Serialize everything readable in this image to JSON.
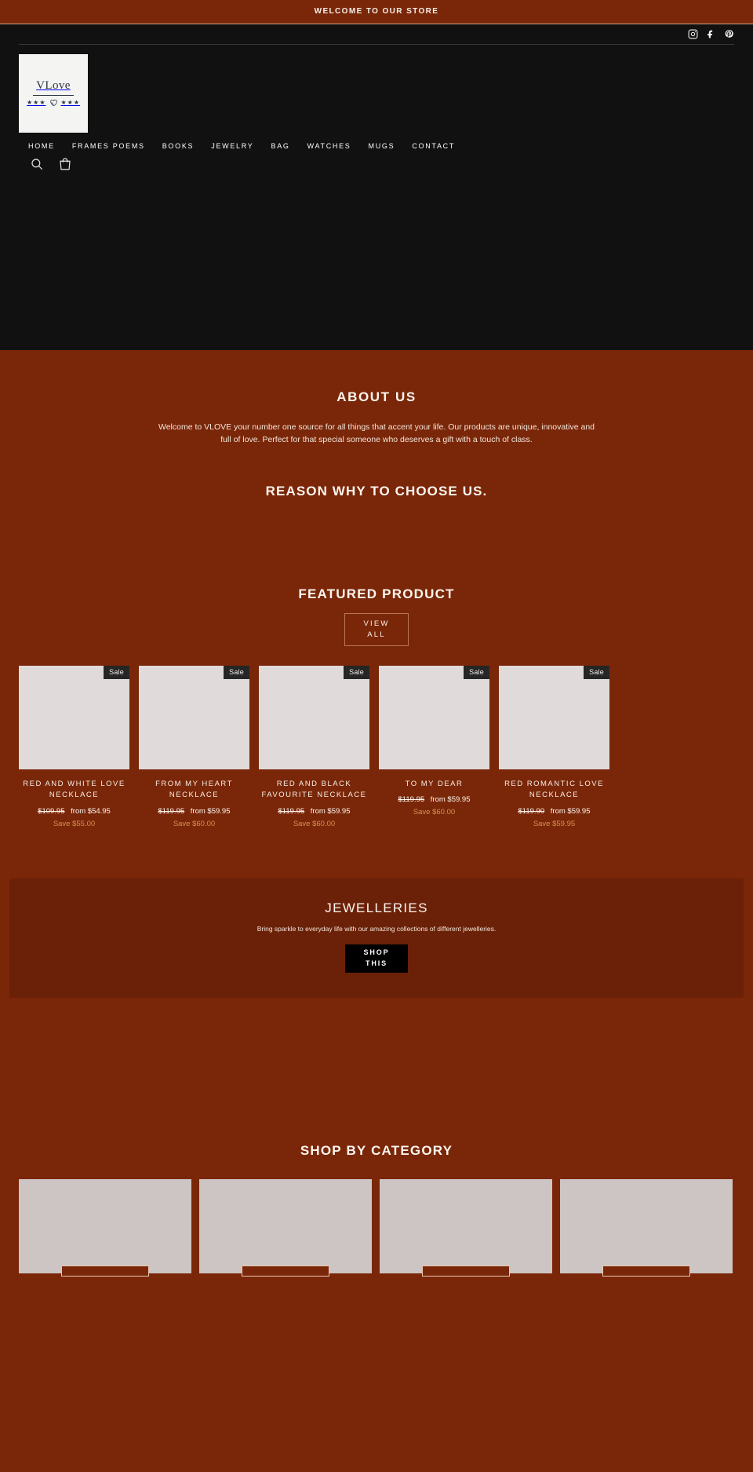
{
  "announcement": {
    "text": "WELCOME TO OUR STORE"
  },
  "social": [
    {
      "name": "instagram-icon",
      "label": "Instagram"
    },
    {
      "name": "facebook-icon",
      "label": "Facebook"
    },
    {
      "name": "pinterest-icon",
      "label": "Pinterest"
    }
  ],
  "logo": {
    "name": "VLove",
    "stars_left": "★★★",
    "stars_right": "★★★"
  },
  "nav": [
    {
      "label": "HOME"
    },
    {
      "label": "FRAMES POEMS"
    },
    {
      "label": "BOOKS"
    },
    {
      "label": "JEWELRY"
    },
    {
      "label": "BAG"
    },
    {
      "label": "WATCHES"
    },
    {
      "label": "MUGS"
    },
    {
      "label": "CONTACT"
    }
  ],
  "utilities": [
    {
      "name": "search-icon",
      "label": "Search"
    },
    {
      "name": "cart-icon",
      "label": "Cart"
    }
  ],
  "about": {
    "title": "ABOUT US",
    "body": "Welcome to VLOVE your number one source for all things that accent your life. Our products are unique, innovative and full of love. Perfect for that special someone who deserves a gift with a touch of class."
  },
  "reason": {
    "title": "REASON WHY TO CHOOSE US."
  },
  "featured": {
    "title": "FEATURED PRODUCT",
    "view_all_line1": "VIEW",
    "view_all_line2": "ALL",
    "badge_label": "Sale",
    "products": [
      {
        "title": "RED AND WHITE LOVE NECKLACE",
        "old_price": "$109.95",
        "new_price": "from $54.95",
        "save": "Save $55.00",
        "badge": "Sale"
      },
      {
        "title": "FROM MY HEART NECKLACE",
        "old_price": "$119.95",
        "new_price": "from $59.95",
        "save": "Save $60.00",
        "badge": "Sale"
      },
      {
        "title": "RED AND BLACK FAVOURITE NECKLACE",
        "old_price": "$119.95",
        "new_price": "from $59.95",
        "save": "Save $60.00",
        "badge": "Sale"
      },
      {
        "title": "TO MY DEAR",
        "old_price": "$119.95",
        "new_price": "from $59.95",
        "save": "Save $60.00",
        "badge": "Sale"
      },
      {
        "title": "RED ROMANTIC LOVE NECKLACE",
        "old_price": "$119.90",
        "new_price": "from $59.95",
        "save": "Save $59.95",
        "badge": "Sale"
      }
    ]
  },
  "jewelleries": {
    "title": "JEWELLERIES",
    "subtitle": "Bring sparkle to everyday life with our amazing collections of different jewelleries.",
    "button_line1": "SHOP",
    "button_line2": "THIS"
  },
  "categories": {
    "title": "SHOP BY CATEGORY",
    "items": [
      {},
      {},
      {},
      {}
    ]
  },
  "colors": {
    "brand_maroon": "#7a2709",
    "banner_maroon": "#6b2108",
    "header_dark": "#111111",
    "save_gold": "#d4924e",
    "image_placeholder": "#e0dbda"
  }
}
